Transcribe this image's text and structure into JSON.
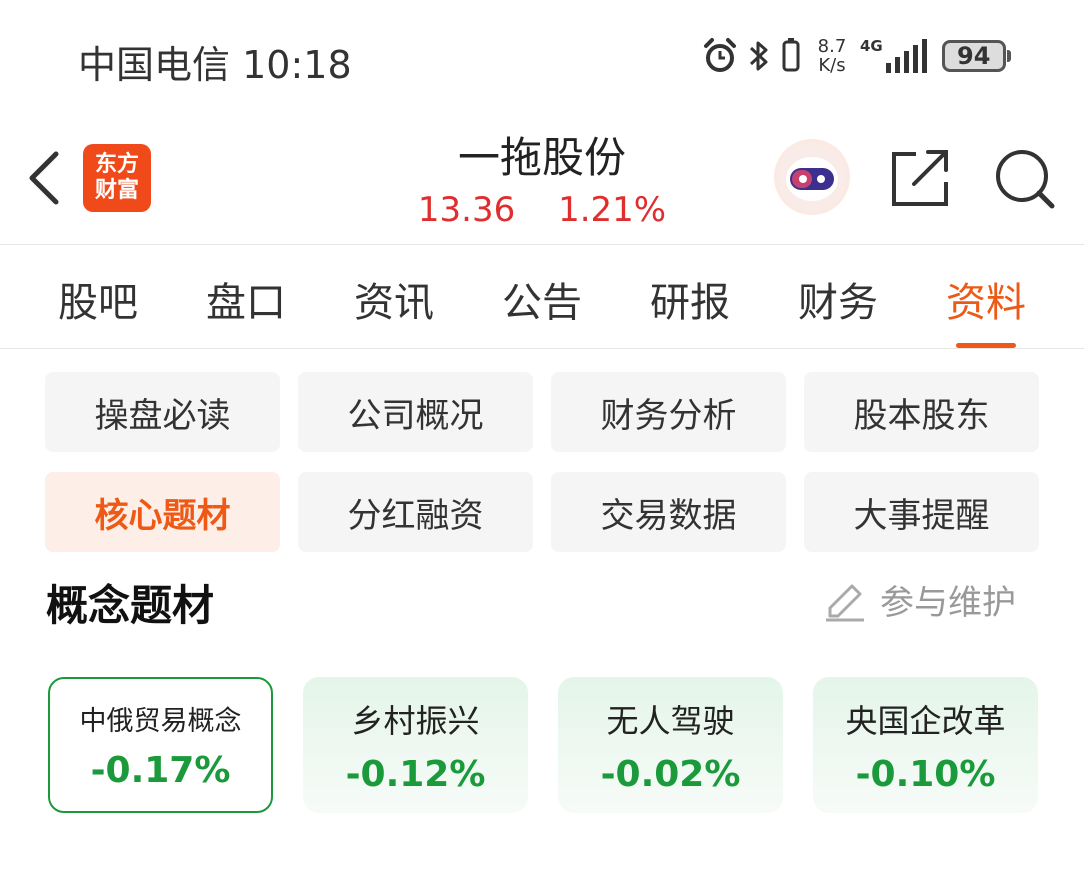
{
  "status_bar": {
    "carrier": "中国电信",
    "time": "10:18",
    "net_speed_value": "8.7",
    "net_speed_unit": "K/s",
    "network": "4G",
    "battery": "94",
    "icons": [
      "alarm-icon",
      "bluetooth-icon",
      "vibrate-icon",
      "signal-icon",
      "battery-icon"
    ]
  },
  "header": {
    "logo_line1": "东方",
    "logo_line2": "财富",
    "stock_name": "一拖股份",
    "price": "13.36",
    "change_pct": "1.21%",
    "icons": [
      "back-icon",
      "assistant-robot-icon",
      "share-icon",
      "search-icon"
    ]
  },
  "tabs": [
    {
      "label": "股吧",
      "active": false
    },
    {
      "label": "盘口",
      "active": false
    },
    {
      "label": "资讯",
      "active": false
    },
    {
      "label": "公告",
      "active": false
    },
    {
      "label": "研报",
      "active": false
    },
    {
      "label": "财务",
      "active": false
    },
    {
      "label": "资料",
      "active": true
    }
  ],
  "sub_nav": [
    {
      "label": "操盘必读",
      "active": false
    },
    {
      "label": "公司概况",
      "active": false
    },
    {
      "label": "财务分析",
      "active": false
    },
    {
      "label": "股本股东",
      "active": false
    },
    {
      "label": "核心题材",
      "active": true
    },
    {
      "label": "分红融资",
      "active": false
    },
    {
      "label": "交易数据",
      "active": false
    },
    {
      "label": "大事提醒",
      "active": false
    }
  ],
  "section": {
    "title": "概念题材",
    "maintain_label": "参与维护"
  },
  "concepts": [
    {
      "name": "中俄贸易概念",
      "change": "-0.17%",
      "selected": true
    },
    {
      "name": "乡村振兴",
      "change": "-0.12%",
      "selected": false
    },
    {
      "name": "无人驾驶",
      "change": "-0.02%",
      "selected": false
    },
    {
      "name": "央国企改革",
      "change": "-0.10%",
      "selected": false
    }
  ],
  "colors": {
    "accent": "#ee5a15",
    "up": "#e02e2e",
    "down": "#1a9a3a",
    "logo": "#f04a1b"
  }
}
